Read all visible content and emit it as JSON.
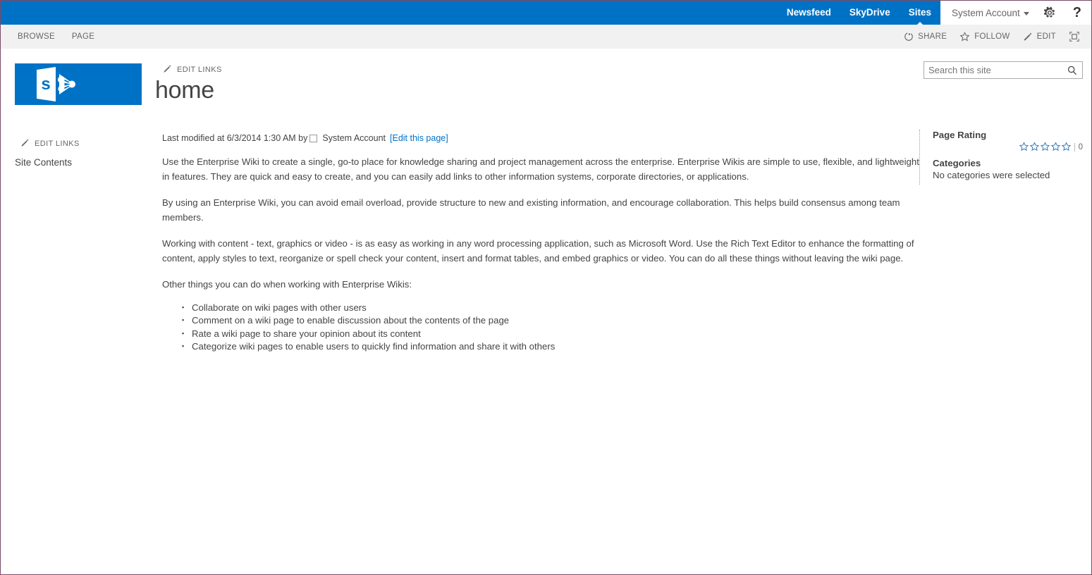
{
  "suite": {
    "links": [
      {
        "label": "Newsfeed",
        "active": false
      },
      {
        "label": "SkyDrive",
        "active": false
      },
      {
        "label": "Sites",
        "active": true
      }
    ],
    "account": "System Account",
    "gear_icon": "gear-icon",
    "help_icon": "help-icon"
  },
  "ribbon": {
    "tabs": [
      {
        "label": "BROWSE"
      },
      {
        "label": "PAGE"
      }
    ],
    "actions": [
      {
        "label": "SHARE",
        "icon": "share-icon"
      },
      {
        "label": "FOLLOW",
        "icon": "star-icon"
      },
      {
        "label": "EDIT",
        "icon": "pencil-icon"
      }
    ],
    "focus_label": "focus-on-content"
  },
  "header": {
    "logo_letter": "s",
    "edit_links_label": "EDIT LINKS",
    "site_title": "home",
    "search": {
      "placeholder": "Search this site",
      "value": ""
    }
  },
  "leftnav": {
    "edit_links_label": "EDIT LINKS",
    "items": [
      {
        "label": "Site Contents"
      }
    ]
  },
  "content": {
    "last_modified_prefix": "Last modified at 6/3/2014 1:30 AM by",
    "author": "System Account",
    "edit_link": "[Edit this page]",
    "paragraphs": [
      "Use the Enterprise Wiki to create a single, go-to place for knowledge sharing and project management across the enterprise. Enterprise Wikis are simple to use, flexible, and lightweight in features. They are quick and easy to create, and you can easily add links to other information systems, corporate directories, or applications.",
      "By using an Enterprise Wiki, you can avoid email overload, provide structure to new and existing information, and encourage collaboration. This helps build consensus among team members.",
      "Working with content - text, graphics or video - is as easy as working in any word processing application, such as Microsoft Word. Use the Rich Text Editor to enhance the formatting of content, apply styles to text, reorganize or spell check your content, insert and format tables, and embed graphics or video. You can do all these things without leaving the wiki page.",
      "Other things you can do when working with Enterprise Wikis:"
    ],
    "bullets": [
      "Collaborate on wiki pages with other users",
      "Comment on a wiki page to enable discussion about the contents of the page",
      "Rate a wiki page to share your opinion about its content",
      "Categorize wiki pages to enable users to quickly find information and share it with others"
    ]
  },
  "rating_panel": {
    "rating_title": "Page Rating",
    "rating_count": "0",
    "stars_total": 5,
    "stars_filled": 0,
    "categories_title": "Categories",
    "categories_value": "No categories were selected"
  },
  "colors": {
    "suite_blue": "#0072c6",
    "ribbon_gray": "#f1f1f1",
    "link_blue": "#0072c6",
    "text_gray": "#444444",
    "window_border": "#7a4a66"
  }
}
